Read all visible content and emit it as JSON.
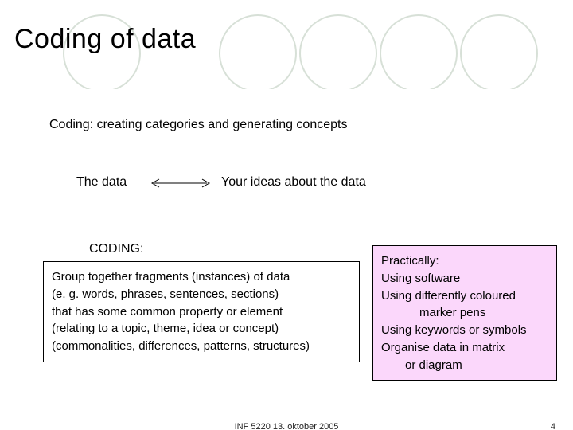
{
  "title": "Coding of data",
  "subtitle": "Coding: creating categories and generating concepts",
  "data_left": "The data",
  "data_right": "Your ideas about the data",
  "coding_label": "CODING:",
  "left_box": {
    "l1": "Group together fragments (instances) of data",
    "l2": "(e. g. words, phrases, sentences, sections)",
    "l3": "that has some common property or element",
    "l4": "(relating to a topic, theme, idea or concept)",
    "l5": "(commonalities, differences, patterns, structures)"
  },
  "right_box": {
    "l1": "Practically:",
    "l2": "Using software",
    "l3": "Using differently coloured",
    "l3b": "marker pens",
    "l4": "Using keywords or symbols",
    "l5": "Organise data in matrix",
    "l5b": "or diagram"
  },
  "footer_center": "INF 5220 13. oktober 2005",
  "footer_right": "4"
}
